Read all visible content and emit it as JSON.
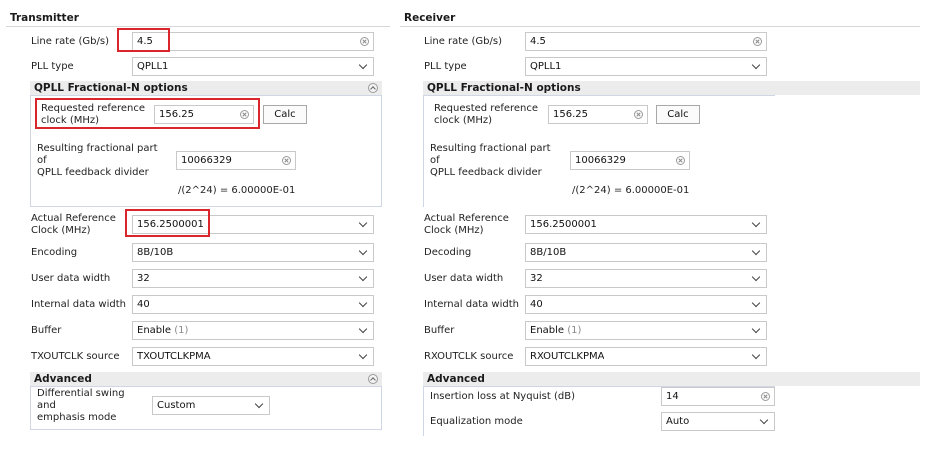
{
  "transmitter": {
    "title": "Transmitter",
    "line_rate_label": "Line rate (Gb/s)",
    "line_rate_value": "4.5",
    "pll_type_label": "PLL type",
    "pll_type_value": "QPLL1",
    "frac_title": "QPLL Fractional-N options",
    "req_clock_label_1": "Requested reference",
    "req_clock_label_2": "clock (MHz)",
    "req_clock_value": "156.25",
    "calc_label": "Calc",
    "frac_label_1": "Resulting fractional part",
    "frac_label_2": "of",
    "frac_label_3": "QPLL feedback divider",
    "frac_value": "10066329",
    "frac_formula": "/(2^24) = 6.00000E-01",
    "actual_clock_label_1": "Actual Reference",
    "actual_clock_label_2": "Clock (MHz)",
    "actual_clock_value": "156.2500001",
    "encoding_label": "Encoding",
    "encoding_value": "8B/10B",
    "user_width_label": "User data width",
    "user_width_value": "32",
    "internal_width_label": "Internal data width",
    "internal_width_value": "40",
    "buffer_label": "Buffer",
    "buffer_value": "Enable",
    "buffer_hint": "(1)",
    "outclk_label": "TXOUTCLK source",
    "outclk_value": "TXOUTCLKPMA",
    "advanced_title": "Advanced",
    "swing_label_1": "Differential swing",
    "swing_label_2": "and",
    "swing_label_3": "emphasis mode",
    "swing_value": "Custom"
  },
  "receiver": {
    "title": "Receiver",
    "line_rate_label": "Line rate (Gb/s)",
    "line_rate_value": "4.5",
    "pll_type_label": "PLL type",
    "pll_type_value": "QPLL1",
    "frac_title": "QPLL Fractional-N options",
    "req_clock_label_1": "Requested reference",
    "req_clock_label_2": "clock (MHz)",
    "req_clock_value": "156.25",
    "calc_label": "Calc",
    "frac_label_1": "Resulting fractional part",
    "frac_label_2": "of",
    "frac_label_3": "QPLL feedback divider",
    "frac_value": "10066329",
    "frac_formula": "/(2^24) = 6.00000E-01",
    "actual_clock_label_1": "Actual Reference",
    "actual_clock_label_2": "Clock (MHz)",
    "actual_clock_value": "156.2500001",
    "decoding_label": "Decoding",
    "decoding_value": "8B/10B",
    "user_width_label": "User data width",
    "user_width_value": "32",
    "internal_width_label": "Internal data width",
    "internal_width_value": "40",
    "buffer_label": "Buffer",
    "buffer_value": "Enable",
    "buffer_hint": "(1)",
    "outclk_label": "RXOUTCLK source",
    "outclk_value": "RXOUTCLKPMA",
    "advanced_title": "Advanced",
    "insertion_loss_label": "Insertion loss at Nyquist (dB)",
    "insertion_loss_value": "14",
    "equalization_label": "Equalization mode",
    "equalization_value": "Auto"
  },
  "colors": {
    "highlight": "#d9262c",
    "group_header": "#ececec",
    "group_border": "#cfd6e4"
  },
  "icons": [
    "clear-icon",
    "chevron-down-icon",
    "collapse-icon"
  ]
}
